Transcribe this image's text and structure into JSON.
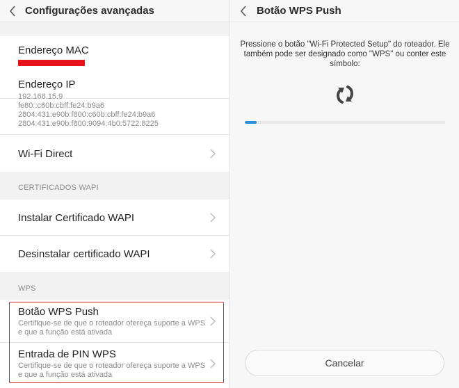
{
  "left": {
    "title": "Configurações avançadas",
    "mac": {
      "label": "Endereço MAC"
    },
    "ip": {
      "label": "Endereço IP",
      "lines": [
        "192.168.15.9",
        "fe80::c60b:cbff:fe24:b9a6",
        "2804:431:e90b:f800:c60b:cbff:fe24:b9a6",
        "2804:431:e90b:f800:9094:4b0:5722:8225"
      ]
    },
    "wifi_direct": "Wi-Fi Direct",
    "cert_section": "CERTIFICADOS WAPI",
    "install_cert": "Instalar Certificado WAPI",
    "uninstall_cert": "Desinstalar certificado WAPI",
    "wps_section": "WPS",
    "wps_push": {
      "title": "Botão WPS Push",
      "sub": "Certifique-se de que o roteador ofereça suporte a WPS e que a função está ativada"
    },
    "wps_pin": {
      "title": "Entrada de PIN WPS",
      "sub": "Certifique-se de que o roteador ofereça suporte a WPS e que a função está ativada"
    }
  },
  "right": {
    "title": "Botão WPS Push",
    "description": "Pressione o botão \"Wi-Fi Protected Setup\" do roteador. Ele também pode ser designado como \"WPS\" ou conter este símbolo:",
    "progress_fraction": 0.06,
    "cancel_label": "Cancelar"
  },
  "colors": {
    "accent": "#2b8fd8",
    "redaction": "#e8121a",
    "highlight_border": "#d8262b"
  },
  "icons": {
    "back": "chevron-left-icon",
    "row_arrow": "chevron-right-icon",
    "wps": "wps-symbol-icon"
  }
}
